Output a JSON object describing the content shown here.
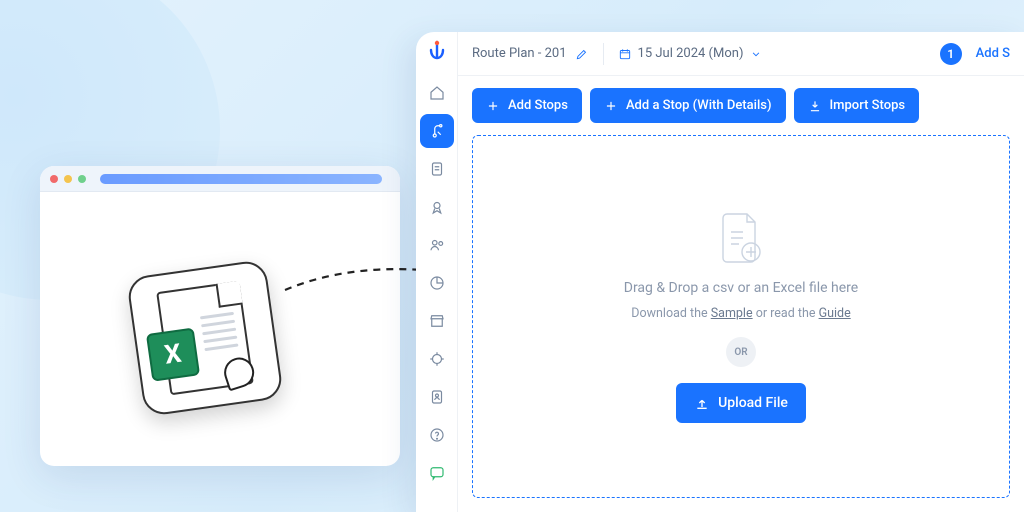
{
  "route": {
    "name": "Route Plan - 201",
    "date": "15 Jul 2024 (Mon)"
  },
  "step": {
    "number": "1",
    "label": "Add S"
  },
  "buttons": {
    "add_stops": "Add Stops",
    "add_stop_details": "Add a Stop (With Details)",
    "import_stops": "Import Stops"
  },
  "dropzone": {
    "title": "Drag & Drop a csv or an Excel file here",
    "download_prefix": "Download the ",
    "sample": "Sample",
    "middle": " or read the ",
    "guide": "Guide",
    "or": "OR",
    "upload": "Upload File"
  },
  "excel_letter": "X"
}
